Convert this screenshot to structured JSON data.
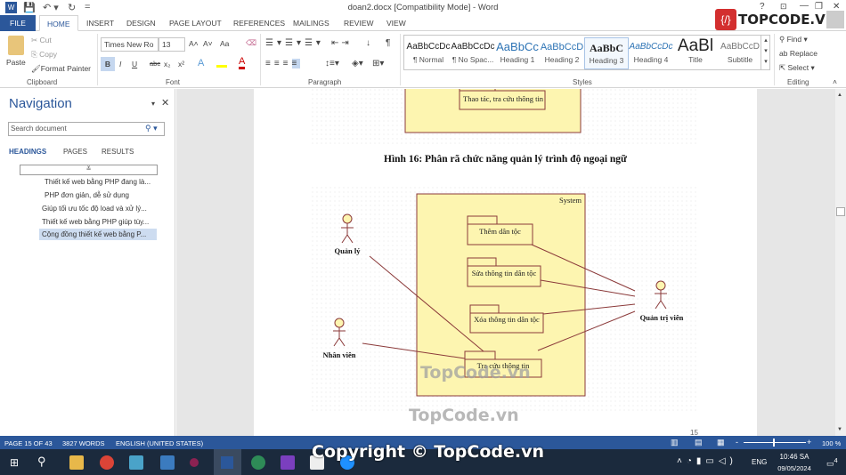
{
  "window": {
    "title": "doan2.docx [Compatibility Mode] - Word",
    "help": "?",
    "minimize": "—",
    "restore": "❐",
    "close": "✕"
  },
  "tabs": [
    "FILE",
    "HOME",
    "INSERT",
    "DESIGN",
    "PAGE LAYOUT",
    "REFERENCES",
    "MAILINGS",
    "REVIEW",
    "VIEW"
  ],
  "ribbon": {
    "clipboard": {
      "paste": "Paste",
      "cut": "Cut",
      "copy": "Copy",
      "format_painter": "Format Painter",
      "label": "Clipboard"
    },
    "font": {
      "name": "Times New Ro",
      "size": "13",
      "label": "Font",
      "bold": "B",
      "italic": "I",
      "underline": "U",
      "strike": "abc",
      "sub": "x₂",
      "sup": "x²",
      "grow": "A˄",
      "shrink": "A˅",
      "case": "Aa"
    },
    "paragraph": {
      "label": "Paragraph",
      "pilcrow": "¶"
    },
    "styles": {
      "label": "Styles",
      "items": [
        {
          "preview": "AaBbCcDc",
          "name": "¶ Normal"
        },
        {
          "preview": "AaBbCcDc",
          "name": "¶ No Spac..."
        },
        {
          "preview": "AaBbCc",
          "name": "Heading 1"
        },
        {
          "preview": "AaBbCcD",
          "name": "Heading 2"
        },
        {
          "preview": "AaBbC",
          "name": "Heading 3"
        },
        {
          "preview": "AaBbCcDc",
          "name": "Heading 4"
        },
        {
          "preview": "AaBl",
          "name": "Title"
        },
        {
          "preview": "AaBbCcD",
          "name": "Subtitle"
        }
      ],
      "selected": "Heading 3"
    },
    "editing": {
      "label": "Editing",
      "find": "Find",
      "replace": "Replace",
      "select": "Select"
    }
  },
  "brand": "TOPCODE.VN",
  "navigation": {
    "title": "Navigation",
    "search_placeholder": "Search document",
    "tabs": [
      "HEADINGS",
      "PAGES",
      "RESULTS"
    ],
    "active_tab": "HEADINGS",
    "items": [
      "Thiết kế web bằng PHP đang là...",
      "PHP đơn giản, dễ sử dụng",
      "Giúp tối ưu tốc độ load và xử lý...",
      "Thiết kế web bằng PHP giúp tùy...",
      "Cộng đồng thiết kế web bằng P..."
    ],
    "selected_index": 4
  },
  "document": {
    "top_package": "Thao tác, tra cứu thông tin",
    "caption": "Hình 16: Phân rã chức năng quản lý trình độ ngoại ngữ",
    "system_label": "System",
    "packages": [
      "Thêm dân tộc",
      "Sửa thông tin dân tộc",
      "Xóa thông tin dân tộc",
      "Tra cứu thông tin"
    ],
    "actors": [
      "Quản lý",
      "Nhân viên",
      "Quản trị viên"
    ],
    "page_number": "15"
  },
  "watermarks": [
    "TopCode.vn",
    "TopCode.vn",
    "Copyright © TopCode.vn"
  ],
  "status": {
    "page": "PAGE 15 OF 43",
    "words": "3827 WORDS",
    "language": "ENGLISH (UNITED STATES)",
    "zoom": "100 %",
    "zoom_level": 100
  },
  "taskbar": {
    "time": "10:46 SA",
    "date": "09/05/2024",
    "lang": "ENG",
    "notifications": "4"
  }
}
